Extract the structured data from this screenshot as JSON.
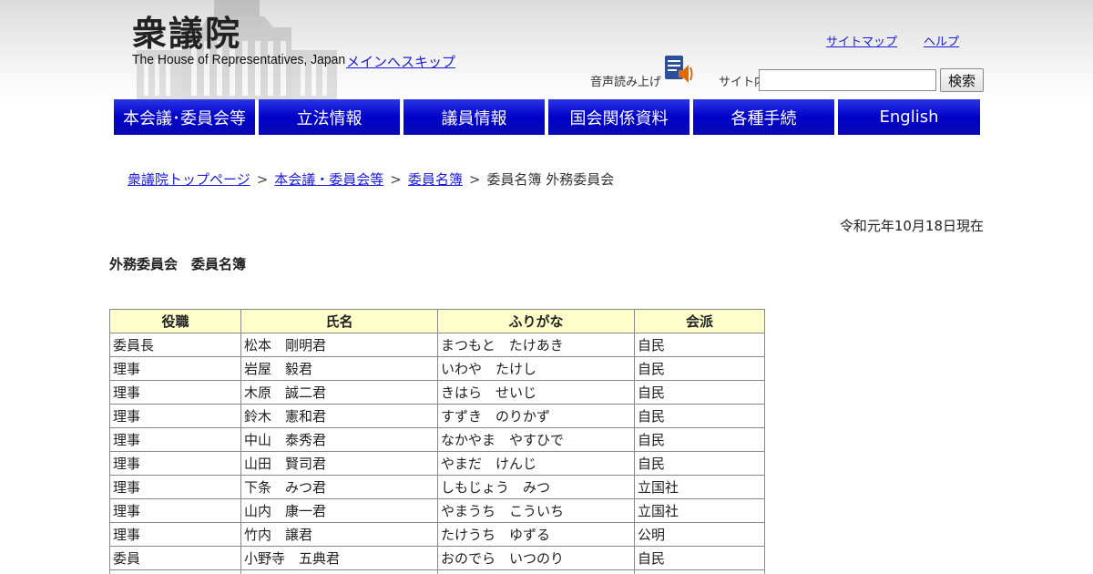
{
  "header": {
    "logo_jp": "衆議院",
    "logo_en": "The House of Representatives, Japan",
    "skip_link": "メインへスキップ",
    "sitemap": "サイトマップ",
    "help": "ヘルプ",
    "tts_label": "音声読み上げ",
    "search_label": "サイト内検索",
    "search_value": "",
    "search_button": "検索"
  },
  "nav": {
    "items": [
      {
        "label": "本会議･委員会等"
      },
      {
        "label": "立法情報"
      },
      {
        "label": "議員情報"
      },
      {
        "label": "国会関係資料"
      },
      {
        "label": "各種手続"
      },
      {
        "label": "English"
      }
    ]
  },
  "breadcrumb": {
    "items": [
      "衆議院トップページ",
      "本会議・委員会等",
      "委員名簿"
    ],
    "separator": ">",
    "current": "委員名簿 外務委員会"
  },
  "date_text": "令和元年10月18日現在",
  "page_title": "外務委員会　委員名簿",
  "table": {
    "headers": [
      "役職",
      "氏名",
      "ふりがな",
      "会派"
    ],
    "rows": [
      [
        "委員長",
        "松本　剛明君",
        "まつもと　たけあき",
        "自民"
      ],
      [
        "理事",
        "岩屋　毅君",
        "いわや　たけし",
        "自民"
      ],
      [
        "理事",
        "木原　誠二君",
        "きはら　せいじ",
        "自民"
      ],
      [
        "理事",
        "鈴木　憲和君",
        "すずき　のりかず",
        "自民"
      ],
      [
        "理事",
        "中山　泰秀君",
        "なかやま　やすひで",
        "自民"
      ],
      [
        "理事",
        "山田　賢司君",
        "やまだ　けんじ",
        "自民"
      ],
      [
        "理事",
        "下条　みつ君",
        "しもじょう　みつ",
        "立国社"
      ],
      [
        "理事",
        "山内　康一君",
        "やまうち　こういち",
        "立国社"
      ],
      [
        "理事",
        "竹内　譲君",
        "たけうち　ゆずる",
        "公明"
      ],
      [
        "委員",
        "小野寺　五典君",
        "おのでら　いつのり",
        "自民"
      ],
      [
        "",
        "",
        "",
        ""
      ]
    ]
  }
}
